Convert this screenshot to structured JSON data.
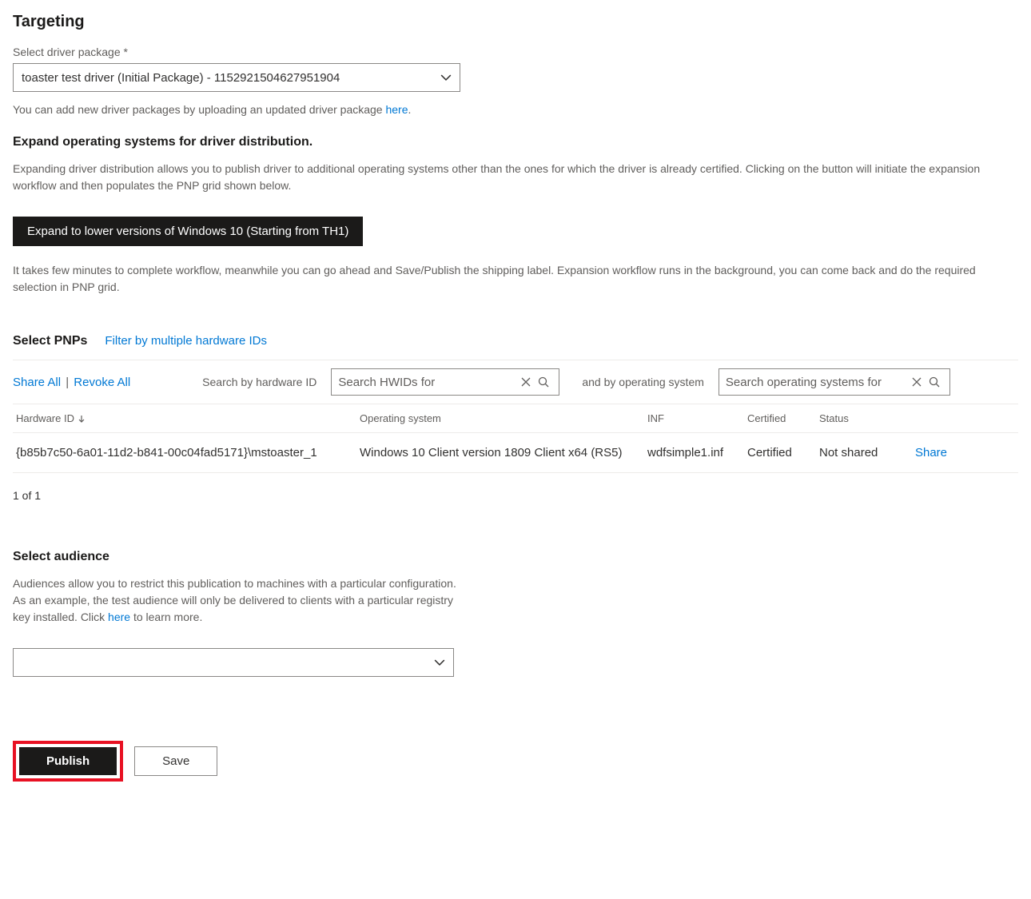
{
  "targeting": {
    "title": "Targeting",
    "select_label": "Select driver package *",
    "dropdown_value": "toaster test driver (Initial Package) - 1152921504627951904",
    "hint_prefix": "You can add new driver packages by uploading an updated driver package ",
    "hint_link": "here",
    "hint_suffix": "."
  },
  "expand": {
    "title": "Expand operating systems for driver distribution.",
    "desc": "Expanding driver distribution allows you to publish driver to additional operating systems other than the ones for which the driver is already certified. Clicking on the button will initiate the expansion workflow and then populates the PNP grid shown below.",
    "button": "Expand to lower versions of Windows 10 (Starting from TH1)",
    "note": "It takes few minutes to complete workflow, meanwhile you can go ahead and Save/Publish the shipping label. Expansion workflow runs in the background, you can come back and do the required selection in PNP grid."
  },
  "pnp": {
    "title": "Select PNPs",
    "filter_link": "Filter by multiple hardware IDs",
    "share_all": "Share All",
    "revoke_all": "Revoke All",
    "search_hw_label": "Search by hardware ID",
    "search_hw_placeholder": "Search HWIDs for",
    "and_label": "and by operating system",
    "search_os_placeholder": "Search operating systems for",
    "columns": {
      "hw": "Hardware ID",
      "os": "Operating system",
      "inf": "INF",
      "cert": "Certified",
      "status": "Status"
    },
    "rows": [
      {
        "hw": "{b85b7c50-6a01-11d2-b841-00c04fad5171}\\mstoaster_1",
        "os": "Windows 10 Client version 1809 Client x64 (RS5)",
        "inf": "wdfsimple1.inf",
        "cert": "Certified",
        "status": "Not shared",
        "action": "Share"
      }
    ],
    "pagination": "1 of 1"
  },
  "audience": {
    "title": "Select audience",
    "desc_prefix": "Audiences allow you to restrict this publication to machines with a particular configuration. As an example, the test audience will only be delivered to clients with a particular registry key installed. Click ",
    "desc_link": "here",
    "desc_suffix": " to learn more."
  },
  "actions": {
    "publish": "Publish",
    "save": "Save"
  }
}
